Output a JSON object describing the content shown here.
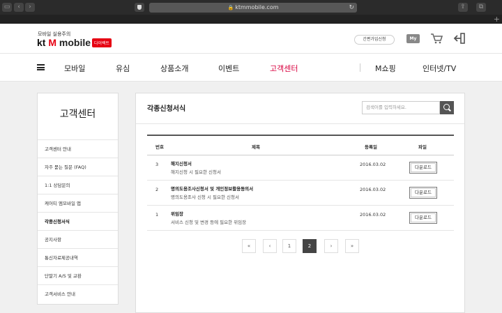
{
  "browser": {
    "url": "ktmmobile.com",
    "lock": "🔒",
    "reload": "↻",
    "back": "‹",
    "forward": "›",
    "sidebar_toggle": "▭",
    "share": "⇪",
    "tabs": "⧉",
    "new_tab": "+"
  },
  "header": {
    "tagline": "모바일 실용주의",
    "logo_kt": "kt",
    "logo_m": "M",
    "logo_mobile": "mobile",
    "direct_badge": "다이렉트",
    "join_label": "간편가입신청",
    "my_label": "My"
  },
  "nav": {
    "items": [
      "모바일",
      "유심",
      "상품소개",
      "이벤트",
      "고객센터",
      "M쇼핑",
      "인터넷/TV"
    ],
    "active": "고객센터"
  },
  "sidebar": {
    "title": "고객센터",
    "items": [
      "고객센터 안내",
      "자주 묻는 질문 (FAQ)",
      "1:1 상담문의",
      "케어티 엠모바일 앱",
      "각종신청서식",
      "공지사항",
      "통신자료제공내역",
      "단말기 A/S 및 교환",
      "고객서비스 안내"
    ],
    "active": "각종신청서식"
  },
  "main": {
    "title": "각종신청서식",
    "search_placeholder": "검색어를 입력하세요.",
    "columns": {
      "num": "번호",
      "title": "제목",
      "date": "등록일",
      "file": "파일"
    },
    "rows": [
      {
        "num": "3",
        "title": "해지신청서",
        "desc": "해지신청 시 필요한 신청서",
        "date": "2016.03.02",
        "file": "다운로드"
      },
      {
        "num": "2",
        "title": "명의도용조사신청서 및 개인정보활용동의서",
        "desc": "명의도용조사 신청 시 필요한 신청서",
        "date": "2016.03.02",
        "file": "다운로드"
      },
      {
        "num": "1",
        "title": "위임장",
        "desc": "서비스 신청 및 변경 등에 필요한 위임장",
        "date": "2016.03.02",
        "file": "다운로드"
      }
    ],
    "pager": {
      "first": "«",
      "prev": "‹",
      "pages": [
        "1",
        "2"
      ],
      "current": "2",
      "next": "›",
      "last": "»"
    }
  },
  "colors": {
    "brand_red": "#e60012",
    "nav_active": "#d8003e"
  }
}
